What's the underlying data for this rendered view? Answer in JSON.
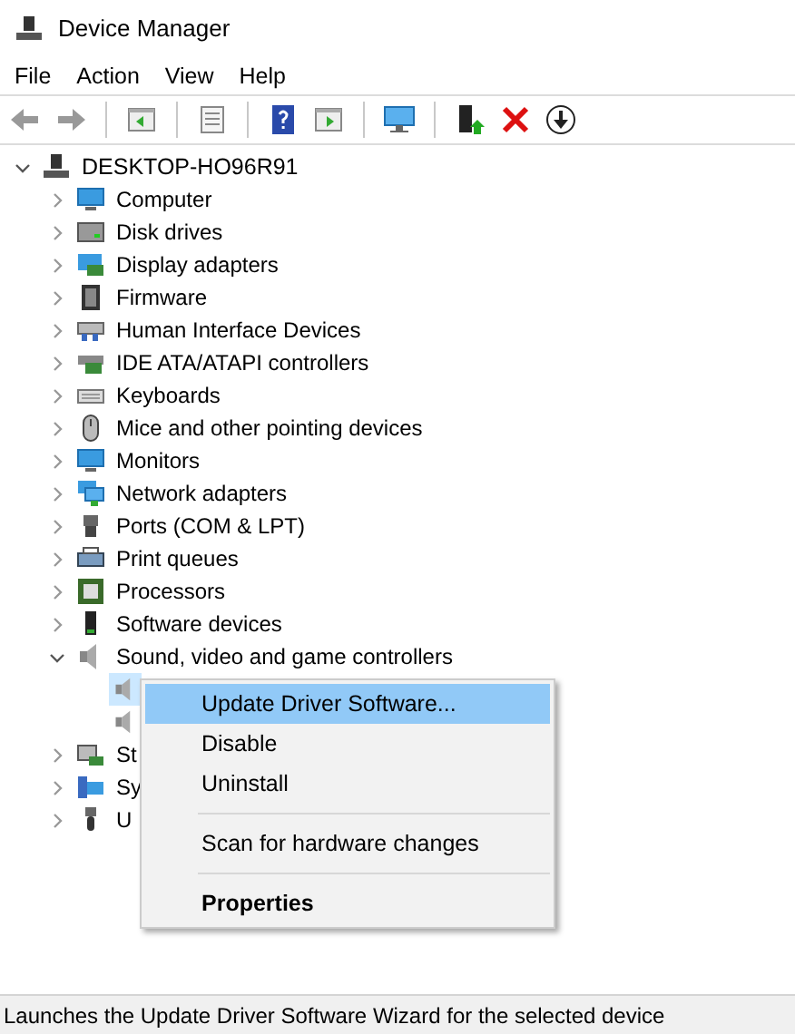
{
  "window": {
    "title": "Device Manager"
  },
  "menu_bar": [
    {
      "label": "File"
    },
    {
      "label": "Action"
    },
    {
      "label": "View"
    },
    {
      "label": "Help"
    }
  ],
  "tree": {
    "label": "DESKTOP-HO96R91",
    "expanded": true,
    "children": [
      {
        "label": "Computer",
        "expanded": false
      },
      {
        "label": "Disk drives",
        "expanded": false
      },
      {
        "label": "Display adapters",
        "expanded": false
      },
      {
        "label": "Firmware",
        "expanded": false
      },
      {
        "label": "Human Interface Devices",
        "expanded": false
      },
      {
        "label": "IDE ATA/ATAPI controllers",
        "expanded": false
      },
      {
        "label": "Keyboards",
        "expanded": false
      },
      {
        "label": "Mice and other pointing devices",
        "expanded": false
      },
      {
        "label": "Monitors",
        "expanded": false
      },
      {
        "label": "Network adapters",
        "expanded": false
      },
      {
        "label": "Ports (COM & LPT)",
        "expanded": false
      },
      {
        "label": "Print queues",
        "expanded": false
      },
      {
        "label": "Processors",
        "expanded": false
      },
      {
        "label": "Software devices",
        "expanded": false
      },
      {
        "label": "Sound, video and game controllers",
        "expanded": true,
        "children": [
          {
            "selected": true
          },
          {
            "selected": false
          }
        ]
      },
      {
        "label": "St",
        "expanded": false
      },
      {
        "label": "Sy",
        "expanded": false
      },
      {
        "label": "U",
        "expanded": false
      }
    ]
  },
  "context_menu": [
    {
      "kind": "item",
      "label": "Update Driver Software...",
      "selected": true,
      "bold": false
    },
    {
      "kind": "item",
      "label": "Disable",
      "selected": false,
      "bold": false
    },
    {
      "kind": "item",
      "label": "Uninstall",
      "selected": false,
      "bold": false
    },
    {
      "kind": "separator"
    },
    {
      "kind": "item",
      "label": "Scan for hardware changes",
      "selected": false,
      "bold": false
    },
    {
      "kind": "separator"
    },
    {
      "kind": "item",
      "label": "Properties",
      "selected": false,
      "bold": true
    }
  ],
  "status_bar": "Launches the Update Driver Software Wizard for the selected device"
}
